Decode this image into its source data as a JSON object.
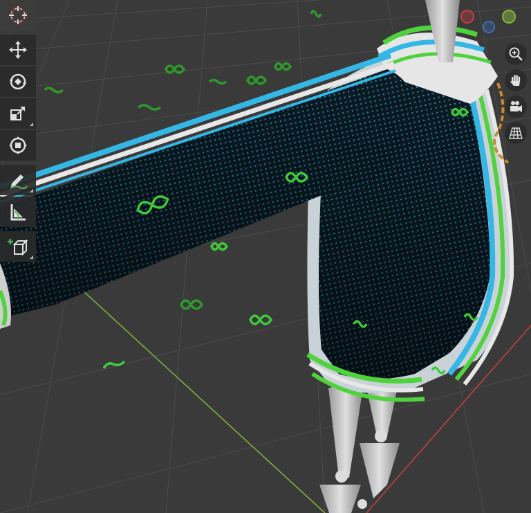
{
  "viewport": {
    "background": "#3a3a3a",
    "grid_color": "#4a4a4a"
  },
  "colors": {
    "axis_x": "#c0413f",
    "axis_y": "#7fae3c",
    "garment_base": "#0c1a22",
    "garment_dots": "#2aa8d8",
    "stripe_green": "#4fd23c",
    "stripe_cyan": "#35b7e6",
    "stripe_white": "#e7e7e7",
    "ik_control": "#3fc93a",
    "bone": "#c8c8c8"
  },
  "toolbar": [
    {
      "name": "cursor-tool",
      "icon": "cursor-icon",
      "active": true
    },
    {
      "name": "move-tool",
      "icon": "move-icon"
    },
    {
      "name": "rotate-tool",
      "icon": "rotate-icon"
    },
    {
      "name": "scale-tool",
      "icon": "scale-icon"
    },
    {
      "name": "transform-tool",
      "icon": "transform-icon"
    },
    {
      "name": "annotate-tool",
      "icon": "annotate-icon"
    },
    {
      "name": "measure-tool",
      "icon": "measure-icon"
    },
    {
      "name": "add-cube-tool",
      "icon": "add-cube-icon"
    }
  ],
  "navigation": [
    {
      "name": "zoom-button",
      "icon": "zoom-icon"
    },
    {
      "name": "pan-button",
      "icon": "hand-icon"
    },
    {
      "name": "camera-button",
      "icon": "camera-icon"
    },
    {
      "name": "perspective-toggle",
      "icon": "grid-icon"
    }
  ],
  "gizmo": {
    "x_color": "#c83c43",
    "y_color": "#86b53a",
    "z_color": "#3d6fb7"
  }
}
